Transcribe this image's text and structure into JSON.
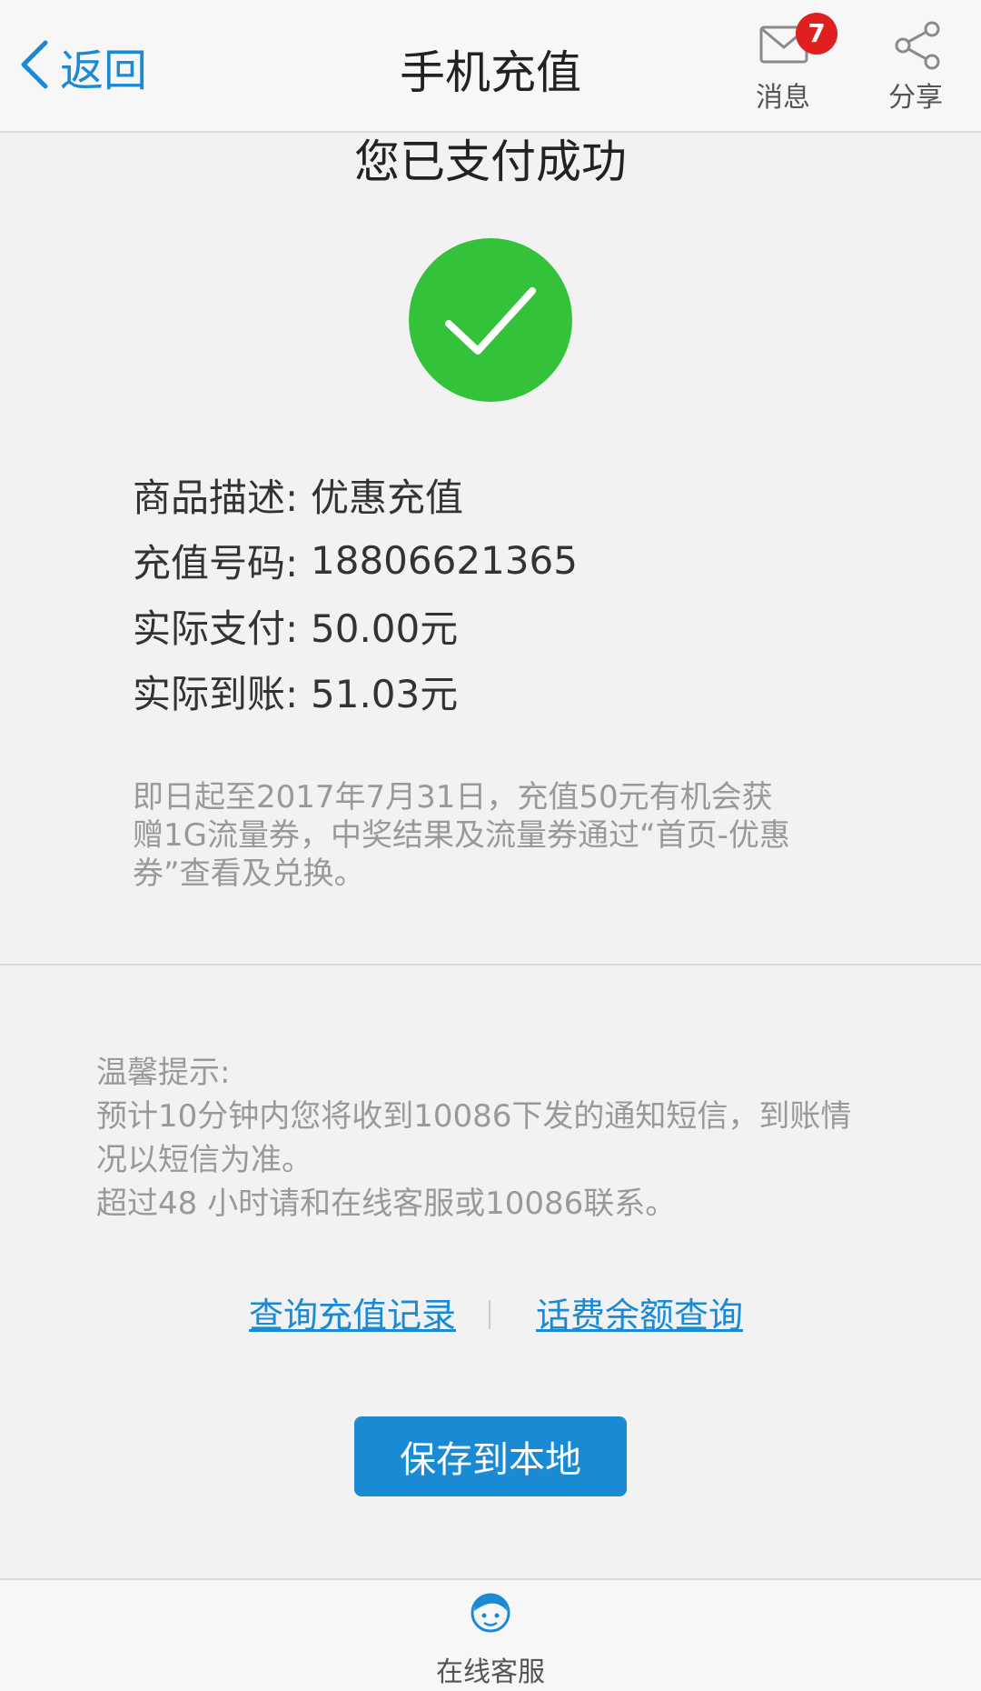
{
  "header": {
    "back_label": "返回",
    "title": "手机充值",
    "messages": {
      "label": "消息",
      "badge": "7"
    },
    "share_label": "分享"
  },
  "success": {
    "title": "您已支付成功",
    "check_color": "#34c23a"
  },
  "details": [
    {
      "key": "商品描述:",
      "value": "优惠充值"
    },
    {
      "key": "充值号码:",
      "value": "18806621365"
    },
    {
      "key": "实际支付:",
      "value": "50.00元"
    },
    {
      "key": "实际到账:",
      "value": "51.03元"
    }
  ],
  "promo": {
    "line1": "即日起至2017年7月31日，充值50元有机会获",
    "line2": "赠1G流量券，中奖结果及流量券通过“首页-优惠",
    "line3": "券”查看及兑换。"
  },
  "tips": {
    "heading": "温馨提示:",
    "line1": "预计10分钟内您将收到10086下发的通知短信，到账情",
    "line2": "况以短信为准。",
    "line3": "超过48 小时请和在线客服或10086联系。"
  },
  "links": {
    "recharge_records": "查询充值记录",
    "balance_query": "话费余额查询"
  },
  "save_button": "保存到本地",
  "footer": {
    "service_label": "在线客服"
  },
  "colors": {
    "accent": "#1a8ad4",
    "badge": "#e02020",
    "success": "#34c23a"
  }
}
